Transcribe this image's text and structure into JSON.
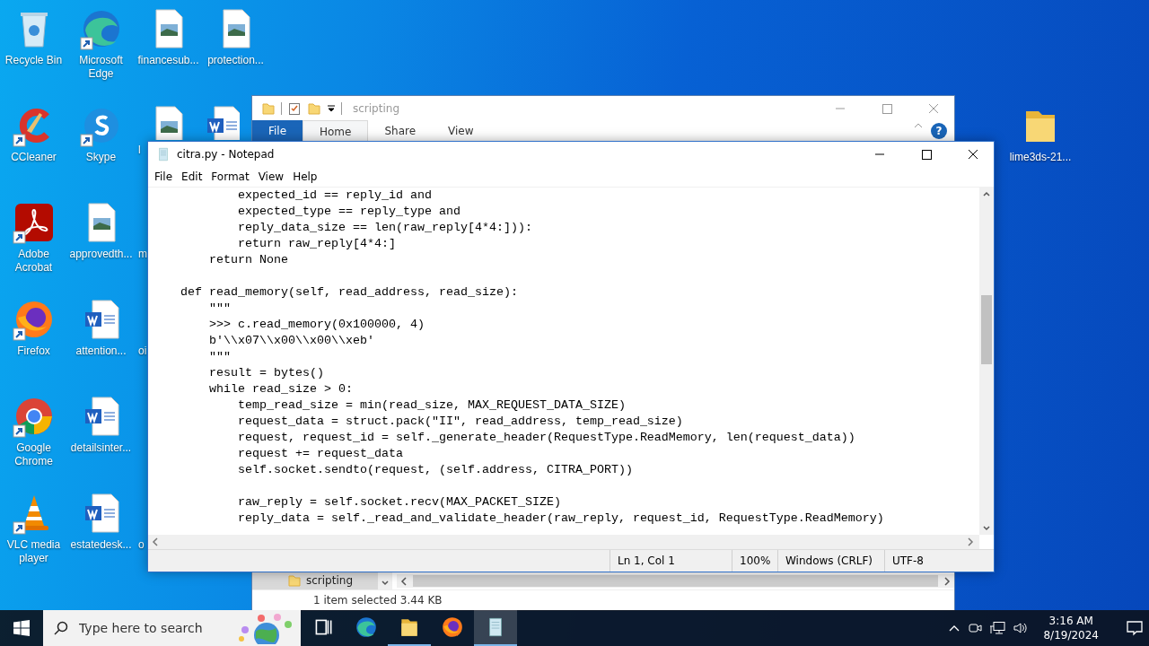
{
  "desktop": {
    "columns": [
      [
        {
          "kind": "trash",
          "label": "Recycle Bin",
          "shortcut": false
        },
        {
          "kind": "arc",
          "label": "CCleaner",
          "shortcut": true
        },
        {
          "kind": "curl",
          "label": "Adobe Acrobat",
          "shortcut": true
        },
        {
          "kind": "flame",
          "label": "Firefox",
          "shortcut": true
        },
        {
          "kind": "ring",
          "label": "Google Chrome",
          "shortcut": true
        },
        {
          "kind": "cone",
          "label": "VLC media player",
          "shortcut": true
        }
      ],
      [
        {
          "kind": "wave",
          "label": "Microsoft Edge",
          "shortcut": true
        },
        {
          "kind": "bubble",
          "label": "Skype",
          "shortcut": true
        },
        {
          "kind": "image",
          "label": "approvedth...",
          "shortcut": false
        },
        {
          "kind": "word",
          "label": "attention...",
          "shortcut": false
        },
        {
          "kind": "word",
          "label": "detailsinter...",
          "shortcut": false
        },
        {
          "kind": "word",
          "label": "estatedesk...",
          "shortcut": false
        }
      ],
      [
        {
          "kind": "image",
          "label": "financesub...",
          "shortcut": false
        },
        {
          "kind": "image",
          "label": "l",
          "shortcut": false
        },
        {
          "kind": "covered",
          "label": "m"
        },
        {
          "kind": "covered",
          "label": "oi"
        },
        {
          "kind": "covered"
        },
        {
          "kind": "covered",
          "label": "o"
        }
      ],
      [
        {
          "kind": "image",
          "label": "protection...",
          "shortcut": false
        },
        {
          "kind": "word",
          "shortcut": false
        }
      ]
    ],
    "right_icons": [
      {
        "kind": "folder",
        "label": "lime3ds-21...",
        "shortcut": false
      }
    ]
  },
  "explorer": {
    "title": "scripting",
    "ribbon_tabs": [
      {
        "label": "File",
        "kind": "file",
        "selected": false
      },
      {
        "label": "Home",
        "kind": "tab",
        "selected": true
      },
      {
        "label": "Share",
        "kind": "tab",
        "selected": false
      },
      {
        "label": "View",
        "kind": "tab",
        "selected": false
      }
    ],
    "help": "?",
    "nav_items": [
      {
        "label": "scripting",
        "selected": true
      }
    ],
    "status": "1 item selected  3.44 KB"
  },
  "notepad": {
    "title": "citra.py - Notepad",
    "menu": [
      "File",
      "Edit",
      "Format",
      "View",
      "Help"
    ],
    "code": "            expected_id == reply_id and\n            expected_type == reply_type and\n            reply_data_size == len(raw_reply[4*4:])):\n            return raw_reply[4*4:]\n        return None\n\n    def read_memory(self, read_address, read_size):\n        \"\"\"\n        >>> c.read_memory(0x100000, 4)\n        b'\\\\x07\\\\x00\\\\x00\\\\xeb'\n        \"\"\"\n        result = bytes()\n        while read_size > 0:\n            temp_read_size = min(read_size, MAX_REQUEST_DATA_SIZE)\n            request_data = struct.pack(\"II\", read_address, temp_read_size)\n            request, request_id = self._generate_header(RequestType.ReadMemory, len(request_data))\n            request += request_data\n            self.socket.sendto(request, (self.address, CITRA_PORT))\n\n            raw_reply = self.socket.recv(MAX_PACKET_SIZE)\n            reply_data = self._read_and_validate_header(raw_reply, request_id, RequestType.ReadMemory)",
    "status": [
      "Ln 1, Col 1",
      "100%",
      "Windows (CRLF)",
      "UTF-8"
    ]
  },
  "taskbar": {
    "search_placeholder": "Type here to search",
    "apps": [
      {
        "kind": "taskview",
        "running": false,
        "selected": false
      },
      {
        "kind": "wave",
        "running": false,
        "selected": false
      },
      {
        "kind": "folder",
        "running": true,
        "selected": false
      },
      {
        "kind": "flame",
        "running": false,
        "selected": false
      },
      {
        "kind": "notepad",
        "running": true,
        "selected": true
      }
    ],
    "time": "3:16 AM",
    "date": "8/19/2024"
  }
}
